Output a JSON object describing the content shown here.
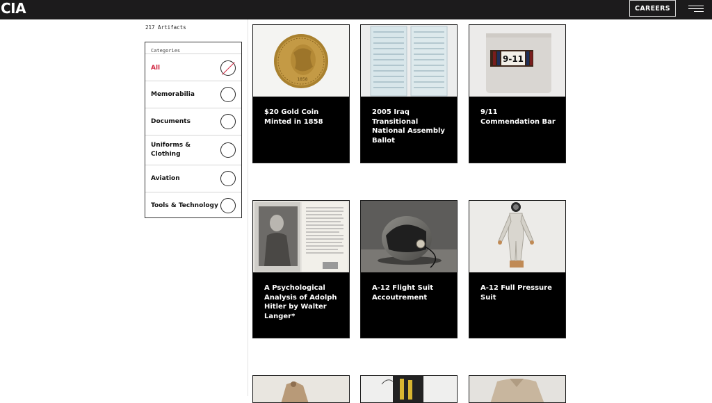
{
  "header": {
    "logo": "CIA",
    "careers_label": "CAREERS"
  },
  "sidebar": {
    "count": "217 Artifacts",
    "categories_title": "Categories",
    "categories": [
      {
        "label": "All",
        "active": true
      },
      {
        "label": "Memorabilia",
        "active": false
      },
      {
        "label": "Documents",
        "active": false
      },
      {
        "label": "Uniforms & Clothing",
        "active": false
      },
      {
        "label": "Aviation",
        "active": false
      },
      {
        "label": "Tools & Technology",
        "active": false
      }
    ]
  },
  "artifacts": [
    {
      "title": "$20 Gold Coin Minted in 1858",
      "image": "gold-coin"
    },
    {
      "title": "2005 Iraq Transitional National Assembly Ballot",
      "image": "ballot"
    },
    {
      "title": "9/11 Commendation Bar",
      "image": "commendation-bar",
      "image_text": "9-11"
    },
    {
      "title": "A Psychological Analysis of Adolph Hitler by Walter Langer*",
      "image": "book"
    },
    {
      "title": "A-12 Flight Suit Accoutrement",
      "image": "helmet"
    },
    {
      "title": "A-12 Full Pressure Suit",
      "image": "pressure-suit"
    }
  ],
  "colors": {
    "header_bg": "#1c1b1c",
    "accent_red": "#d12a44",
    "card_bg": "#000000"
  }
}
